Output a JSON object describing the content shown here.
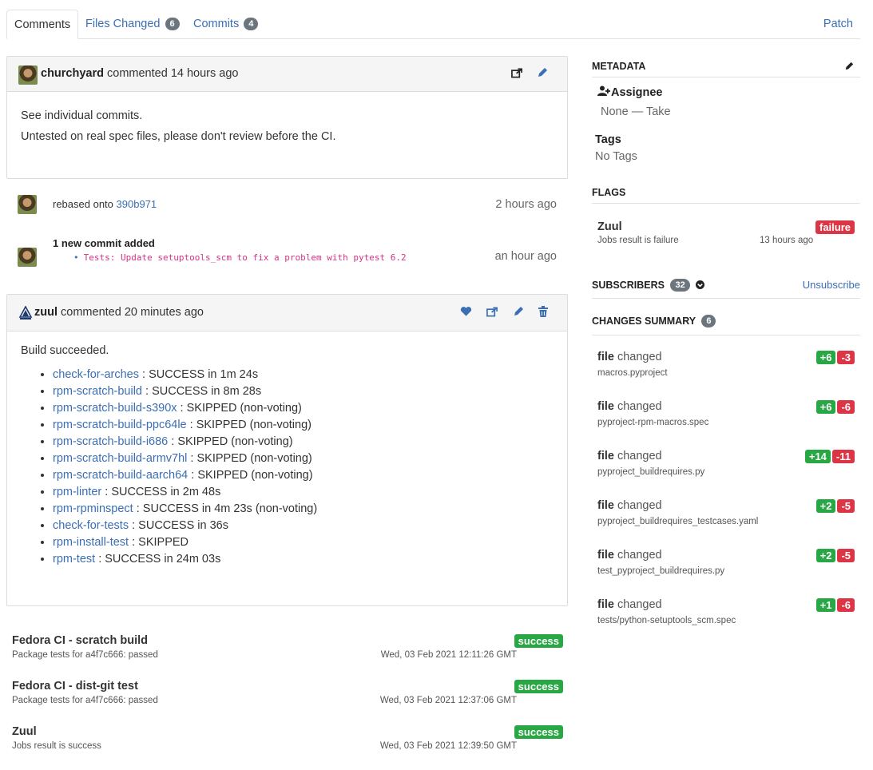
{
  "tabs": {
    "comments": "Comments",
    "files_changed": "Files Changed",
    "files_changed_count": "6",
    "commits": "Commits",
    "commits_count": "4",
    "patch": "Patch"
  },
  "comment1": {
    "author": "churchyard",
    "action": "commented",
    "time": "14 hours ago",
    "body": [
      "See individual commits.",
      "Untested on real spec files, please don't review before the CI."
    ]
  },
  "rebase": {
    "text": "rebased onto",
    "hash": "390b971",
    "time": "2 hours ago"
  },
  "new_commit": {
    "title": "1 new commit added",
    "commit": "Tests: Update setuptools_scm to fix a problem with pytest 6.2",
    "time": "an hour ago"
  },
  "comment2": {
    "author": "zuul",
    "action": "commented",
    "time": "20 minutes ago",
    "intro": "Build succeeded.",
    "jobs": [
      {
        "name": "check-for-arches",
        "result": " : SUCCESS in 1m 24s"
      },
      {
        "name": "rpm-scratch-build",
        "result": " : SUCCESS in 8m 28s"
      },
      {
        "name": "rpm-scratch-build-s390x",
        "result": " : SKIPPED (non-voting)"
      },
      {
        "name": "rpm-scratch-build-ppc64le",
        "result": " : SKIPPED (non-voting)"
      },
      {
        "name": "rpm-scratch-build-i686",
        "result": " : SKIPPED (non-voting)"
      },
      {
        "name": "rpm-scratch-build-armv7hl",
        "result": " : SKIPPED (non-voting)"
      },
      {
        "name": "rpm-scratch-build-aarch64",
        "result": " : SKIPPED (non-voting)"
      },
      {
        "name": "rpm-linter",
        "result": " : SUCCESS in 2m 48s"
      },
      {
        "name": "rpm-rpminspect",
        "result": " : SUCCESS in 4m 23s (non-voting)"
      },
      {
        "name": "check-for-tests",
        "result": " : SUCCESS in 36s"
      },
      {
        "name": "rpm-install-test",
        "result": " : SKIPPED"
      },
      {
        "name": "rpm-test",
        "result": " : SUCCESS in 24m 03s"
      }
    ]
  },
  "ci_flags": [
    {
      "title": "Fedora CI - scratch build",
      "sub": "Package tests for a4f7c666: passed",
      "date": "Wed, 03 Feb 2021 12:11:26 GMT",
      "status": "success"
    },
    {
      "title": "Fedora CI - dist-git test",
      "sub": "Package tests for a4f7c666: passed",
      "date": "Wed, 03 Feb 2021 12:37:06 GMT",
      "status": "success"
    },
    {
      "title": "Zuul",
      "sub": "Jobs result is success",
      "date": "Wed, 03 Feb 2021 12:39:50 GMT",
      "status": "success"
    }
  ],
  "sidebar": {
    "metadata_heading": "METADATA",
    "assignee_label": "Assignee",
    "assignee_value": "None — Take",
    "tags_label": "Tags",
    "tags_value": "No Tags",
    "flags_heading": "FLAGS",
    "flag": {
      "name": "Zuul",
      "sub": "Jobs result is failure",
      "time": "13 hours ago",
      "status": "failure"
    },
    "subscribers_heading": "SUBSCRIBERS",
    "subscribers_count": "32",
    "unsubscribe": "Unsubscribe",
    "changes_heading": "CHANGES SUMMARY",
    "changes_count": "6",
    "changes": [
      {
        "word1": "file",
        "word2": "changed",
        "file": "macros.pyproject",
        "add": "+6",
        "del": "-3"
      },
      {
        "word1": "file",
        "word2": "changed",
        "file": "pyproject-rpm-macros.spec",
        "add": "+6",
        "del": "-6"
      },
      {
        "word1": "file",
        "word2": "changed",
        "file": "pyproject_buildrequires.py",
        "add": "+14",
        "del": "-11"
      },
      {
        "word1": "file",
        "word2": "changed",
        "file": "pyproject_buildrequires_testcases.yaml",
        "add": "+2",
        "del": "-5"
      },
      {
        "word1": "file",
        "word2": "changed",
        "file": "test_pyproject_buildrequires.py",
        "add": "+2",
        "del": "-5"
      },
      {
        "word1": "file",
        "word2": "changed",
        "file": "tests/python-setuptools_scm.spec",
        "add": "+1",
        "del": "-6"
      }
    ]
  },
  "colors": {
    "link": "#3c6eb4",
    "success": "#28a745",
    "danger": "#dc3545",
    "commit": "#d63384"
  }
}
